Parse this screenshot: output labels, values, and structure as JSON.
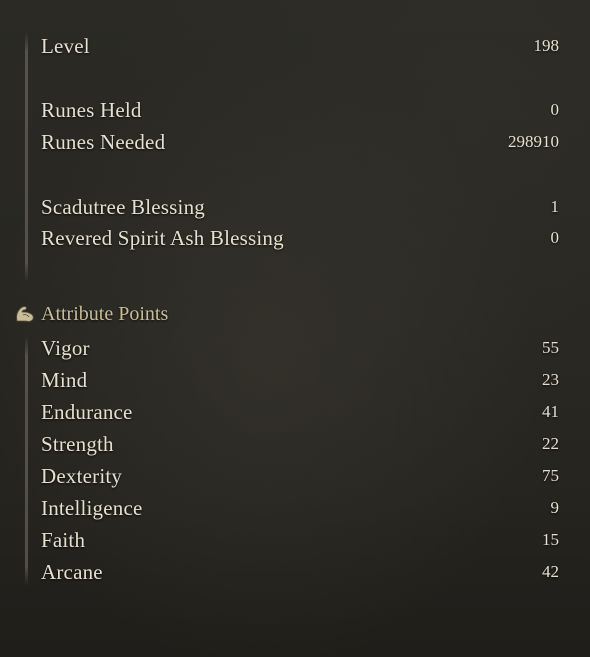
{
  "status": {
    "level": {
      "label": "Level",
      "value": "198"
    },
    "runes_held": {
      "label": "Runes Held",
      "value": "0"
    },
    "runes_needed": {
      "label": "Runes Needed",
      "value": "298910"
    },
    "scadutree_blessing": {
      "label": "Scadutree Blessing",
      "value": "1"
    },
    "revered_spirit_ash_blessing": {
      "label": "Revered Spirit Ash Blessing",
      "value": "0"
    }
  },
  "attributes": {
    "title": "Attribute Points",
    "icon": "flexed-arm-icon",
    "items": [
      {
        "label": "Vigor",
        "value": "55"
      },
      {
        "label": "Mind",
        "value": "23"
      },
      {
        "label": "Endurance",
        "value": "41"
      },
      {
        "label": "Strength",
        "value": "22"
      },
      {
        "label": "Dexterity",
        "value": "75"
      },
      {
        "label": "Intelligence",
        "value": "9"
      },
      {
        "label": "Faith",
        "value": "15"
      },
      {
        "label": "Arcane",
        "value": "42"
      }
    ]
  },
  "colors": {
    "text": "#e6e0cf",
    "section_title": "#c9bd99",
    "background": "#282722"
  }
}
